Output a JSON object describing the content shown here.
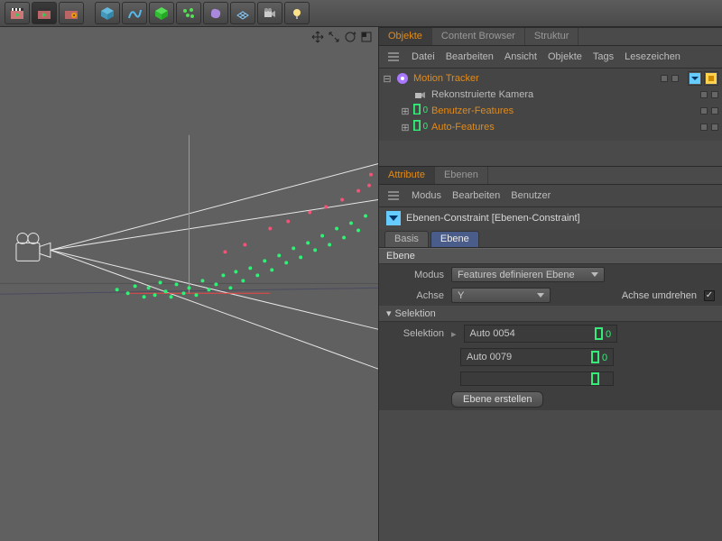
{
  "toolbar": {
    "tools": [
      "clapper-a",
      "clapper-b",
      "clapper-gear",
      "cube",
      "spline",
      "cube-plus",
      "particles",
      "blob",
      "grid",
      "camera",
      "light"
    ]
  },
  "objects_panel": {
    "tabs": [
      "Objekte",
      "Content Browser",
      "Struktur"
    ],
    "active_tab": "Objekte",
    "menu": [
      "Datei",
      "Bearbeiten",
      "Ansicht",
      "Objekte",
      "Tags",
      "Lesezeichen"
    ],
    "tree": [
      {
        "icon": "motion-tracker",
        "label": "Motion Tracker",
        "depth": 0,
        "expanded": true,
        "tags": true
      },
      {
        "icon": "camera",
        "label": "Rekonstruierte Kamera",
        "depth": 1,
        "expanded": null,
        "gray": true
      },
      {
        "icon": "layer-zero",
        "label": "Benutzer-Features",
        "depth": 1,
        "expanded": false
      },
      {
        "icon": "layer-zero",
        "label": "Auto-Features",
        "depth": 1,
        "expanded": false
      }
    ]
  },
  "attributes_panel": {
    "tabs": [
      "Attribute",
      "Ebenen"
    ],
    "active_tab": "Attribute",
    "menu": [
      "Modus",
      "Bearbeiten",
      "Benutzer"
    ],
    "tag_title": "Ebenen-Constraint [Ebenen-Constraint]",
    "attr_tabs": [
      "Basis",
      "Ebene"
    ],
    "active_attr_tab": "Ebene",
    "group_title": "Ebene",
    "modus": {
      "label": "Modus",
      "value": "Features definieren Ebene"
    },
    "achse": {
      "label": "Achse",
      "value": "Y",
      "invert_label": "Achse umdrehen",
      "invert": true
    },
    "selektion_header": "Selektion",
    "selektion_label": "Selektion",
    "selection_items": [
      "Auto 0054",
      "Auto 0079"
    ],
    "create_button": "Ebene erstellen"
  }
}
